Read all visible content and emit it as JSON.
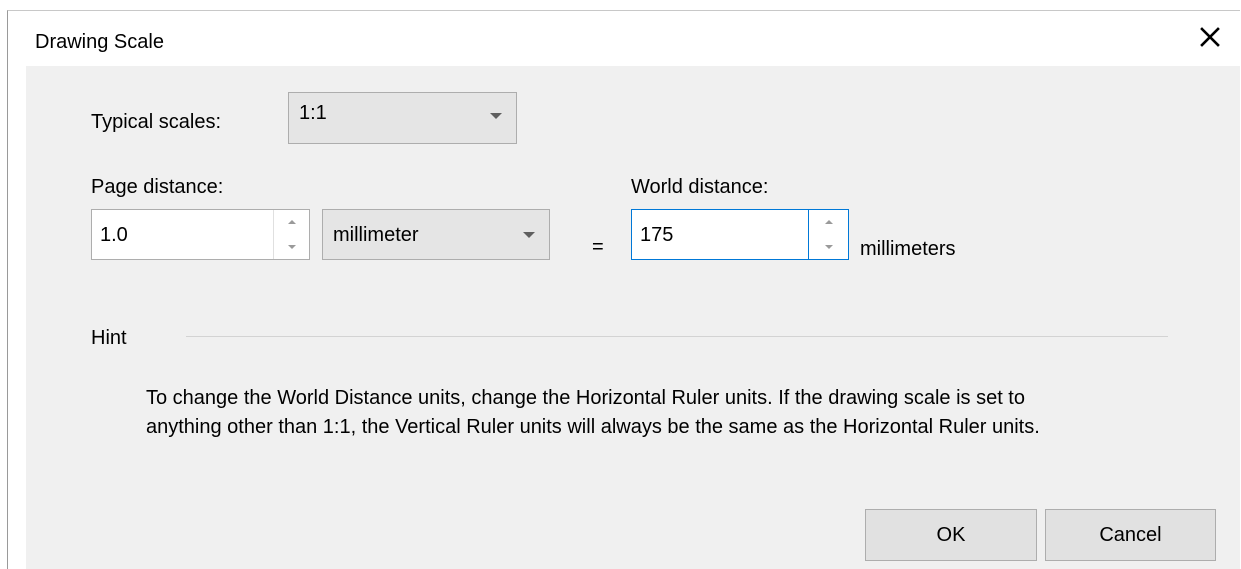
{
  "window": {
    "title": "Drawing Scale"
  },
  "typical_scales": {
    "label": "Typical scales:",
    "selected": "1:1"
  },
  "page_distance": {
    "label": "Page distance:",
    "value": "1.0",
    "unit_selected": "millimeter"
  },
  "equals_sign": "=",
  "world_distance": {
    "label": "World distance:",
    "value": "175",
    "unit_label": "millimeters"
  },
  "hint": {
    "label": "Hint",
    "text": "To change the World Distance units, change the Horizontal Ruler units. If the drawing scale is set to anything other than 1:1, the Vertical Ruler units will always be the same as the Horizontal Ruler units."
  },
  "buttons": {
    "ok_label": "OK",
    "cancel_label": "Cancel"
  },
  "icons": {
    "close": "close-icon",
    "dropdown": "chevron-down-icon",
    "spin_up": "arrow-up-icon",
    "spin_down": "arrow-down-icon"
  },
  "colors": {
    "focus_border": "#0078d7",
    "client_background": "#f0f0f0"
  }
}
